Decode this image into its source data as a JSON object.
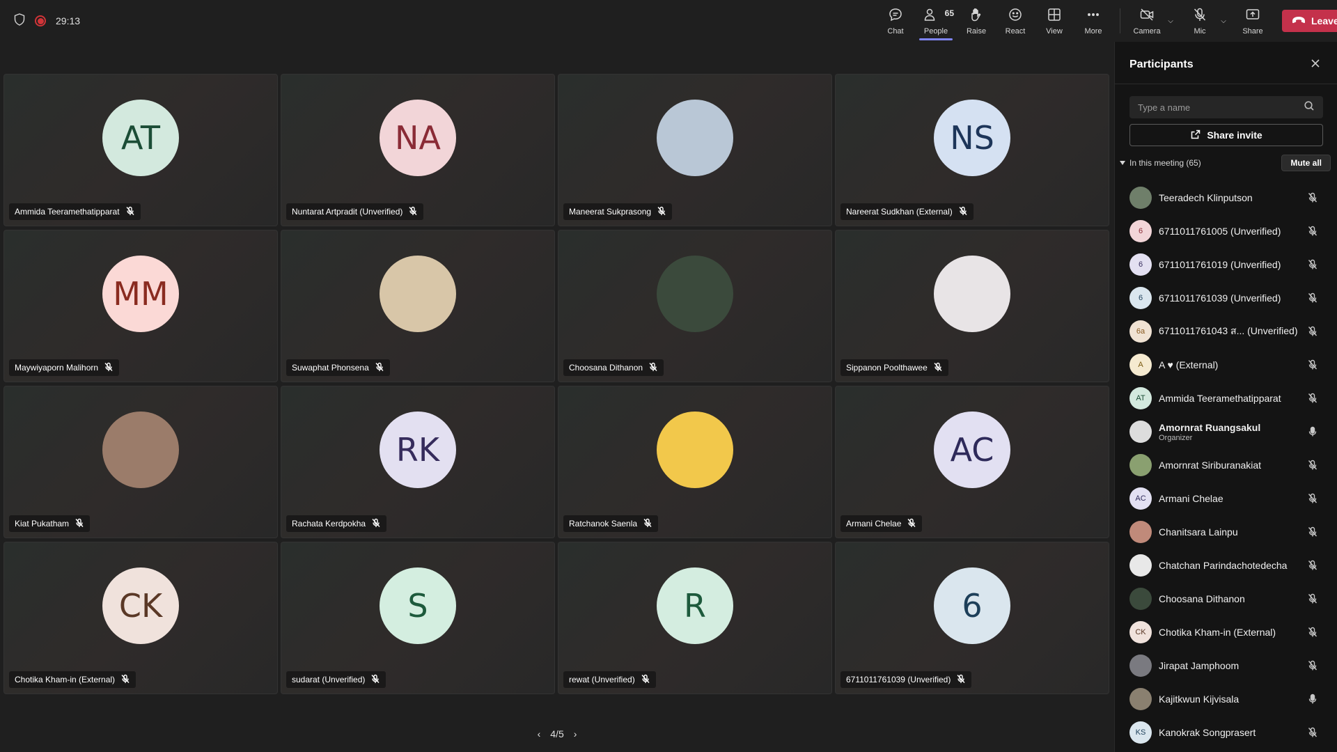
{
  "topbar": {
    "timer": "29:13",
    "chat_label": "Chat",
    "people_label": "People",
    "people_count": "65",
    "raise_label": "Raise",
    "react_label": "React",
    "view_label": "View",
    "more_label": "More",
    "camera_label": "Camera",
    "mic_label": "Mic",
    "share_label": "Share",
    "leave_label": "Leave"
  },
  "tiles": [
    {
      "name": "Ammida Teeramethatipparat",
      "initials": "AT",
      "bg": "#d3e9de",
      "fg": "#1b4d36"
    },
    {
      "name": "Nuntarat Artpradit (Unverified)",
      "initials": "NA",
      "bg": "#f2d5d8",
      "fg": "#8a2b36"
    },
    {
      "name": "Maneerat Sukprasong",
      "initials": "",
      "bg": "#b9c7d6",
      "fg": "#222"
    },
    {
      "name": "Nareerat Sudkhan (External)",
      "initials": "NS",
      "bg": "#d5e1f2",
      "fg": "#1d3559"
    },
    {
      "name": "Maywiyaporn Malihorn",
      "initials": "MM",
      "bg": "#fbd9d6",
      "fg": "#8a2b20"
    },
    {
      "name": "Suwaphat Phonsena",
      "initials": "",
      "bg": "#d8c6a8",
      "fg": "#222"
    },
    {
      "name": "Choosana Dithanon",
      "initials": "",
      "bg": "#3b4a3c",
      "fg": "#fff"
    },
    {
      "name": "Sippanon Poolthawee",
      "initials": "",
      "bg": "#e8e4e6",
      "fg": "#222"
    },
    {
      "name": "Kiat Pukatham",
      "initials": "",
      "bg": "#9b7c6a",
      "fg": "#fff"
    },
    {
      "name": "Rachata Kerdpokha",
      "initials": "RK",
      "bg": "#e3e0f1",
      "fg": "#362c5c"
    },
    {
      "name": "Ratchanok Saenla",
      "initials": "",
      "bg": "#f2c84b",
      "fg": "#222"
    },
    {
      "name": "Armani Chelae",
      "initials": "AC",
      "bg": "#e2e0f2",
      "fg": "#2e2a5a"
    },
    {
      "name": "Chotika Kham-in (External)",
      "initials": "CK",
      "bg": "#f0e2dc",
      "fg": "#5a3826"
    },
    {
      "name": "sudarat (Unverified)",
      "initials": "S",
      "bg": "#d4eee0",
      "fg": "#1d5a3c"
    },
    {
      "name": "rewat (Unverified)",
      "initials": "R",
      "bg": "#d4ede0",
      "fg": "#1d5a3c"
    },
    {
      "name": "6711011761039 (Unverified)",
      "initials": "6",
      "bg": "#dae6ee",
      "fg": "#1d3f59"
    }
  ],
  "pager": {
    "label": "4/5"
  },
  "panel": {
    "title": "Participants",
    "search_placeholder": "Type a name",
    "share_invite_label": "Share invite",
    "section_label": "In this meeting (65)",
    "mute_all_label": "Mute all",
    "participants": [
      {
        "name": "Teeradech Klinputson",
        "role": "",
        "initials": "",
        "bg": "#6f7f6a",
        "fg": "#fff",
        "mic": "muted"
      },
      {
        "name": "6711011761005 (Unverified)",
        "role": "",
        "initials": "6",
        "bg": "#f2d5d8",
        "fg": "#8a2b36",
        "mic": "muted"
      },
      {
        "name": "6711011761019 (Unverified)",
        "role": "",
        "initials": "6",
        "bg": "#e3e0f1",
        "fg": "#362c5c",
        "mic": "muted"
      },
      {
        "name": "6711011761039 (Unverified)",
        "role": "",
        "initials": "6",
        "bg": "#dae6ee",
        "fg": "#1d3f59",
        "mic": "muted"
      },
      {
        "name": "6711011761043 ส...  (Unverified)",
        "role": "",
        "initials": "6a",
        "bg": "#f0e2d3",
        "fg": "#8a5a20",
        "mic": "muted"
      },
      {
        "name": "A ♥ (External)",
        "role": "",
        "initials": "A",
        "bg": "#f5ead0",
        "fg": "#7a5a10",
        "mic": "muted"
      },
      {
        "name": "Ammida Teeramethatipparat",
        "role": "",
        "initials": "AT",
        "bg": "#d3e9de",
        "fg": "#1b4d36",
        "mic": "muted"
      },
      {
        "name": "Amornrat Ruangsakul",
        "role": "Organizer",
        "initials": "",
        "bg": "#ddd",
        "fg": "#222",
        "mic": "on"
      },
      {
        "name": "Amornrat Siriburanakiat",
        "role": "",
        "initials": "",
        "bg": "#8aa070",
        "fg": "#fff",
        "mic": "muted"
      },
      {
        "name": "Armani Chelae",
        "role": "",
        "initials": "AC",
        "bg": "#e2e0f2",
        "fg": "#2e2a5a",
        "mic": "muted"
      },
      {
        "name": "Chanitsara Lainpu",
        "role": "",
        "initials": "",
        "bg": "#c08a7a",
        "fg": "#fff",
        "mic": "muted"
      },
      {
        "name": "Chatchan Parindachotedecha",
        "role": "",
        "initials": "",
        "bg": "#e8e8e8",
        "fg": "#222",
        "mic": "muted"
      },
      {
        "name": "Choosana Dithanon",
        "role": "",
        "initials": "",
        "bg": "#3b4a3c",
        "fg": "#fff",
        "mic": "muted"
      },
      {
        "name": "Chotika Kham-in (External)",
        "role": "",
        "initials": "CK",
        "bg": "#f0e2dc",
        "fg": "#5a3826",
        "mic": "muted"
      },
      {
        "name": "Jirapat Jamphoom",
        "role": "",
        "initials": "",
        "bg": "#7a7a80",
        "fg": "#fff",
        "mic": "muted"
      },
      {
        "name": "Kajitkwun Kijvisala",
        "role": "",
        "initials": "",
        "bg": "#8a8070",
        "fg": "#fff",
        "mic": "on"
      },
      {
        "name": "Kanokrak Songprasert",
        "role": "",
        "initials": "KS",
        "bg": "#dae6ee",
        "fg": "#1d3f59",
        "mic": "muted"
      }
    ]
  },
  "colors": {
    "accent": "#7f85f5",
    "leave": "#c4314b",
    "record": "#d13438"
  }
}
